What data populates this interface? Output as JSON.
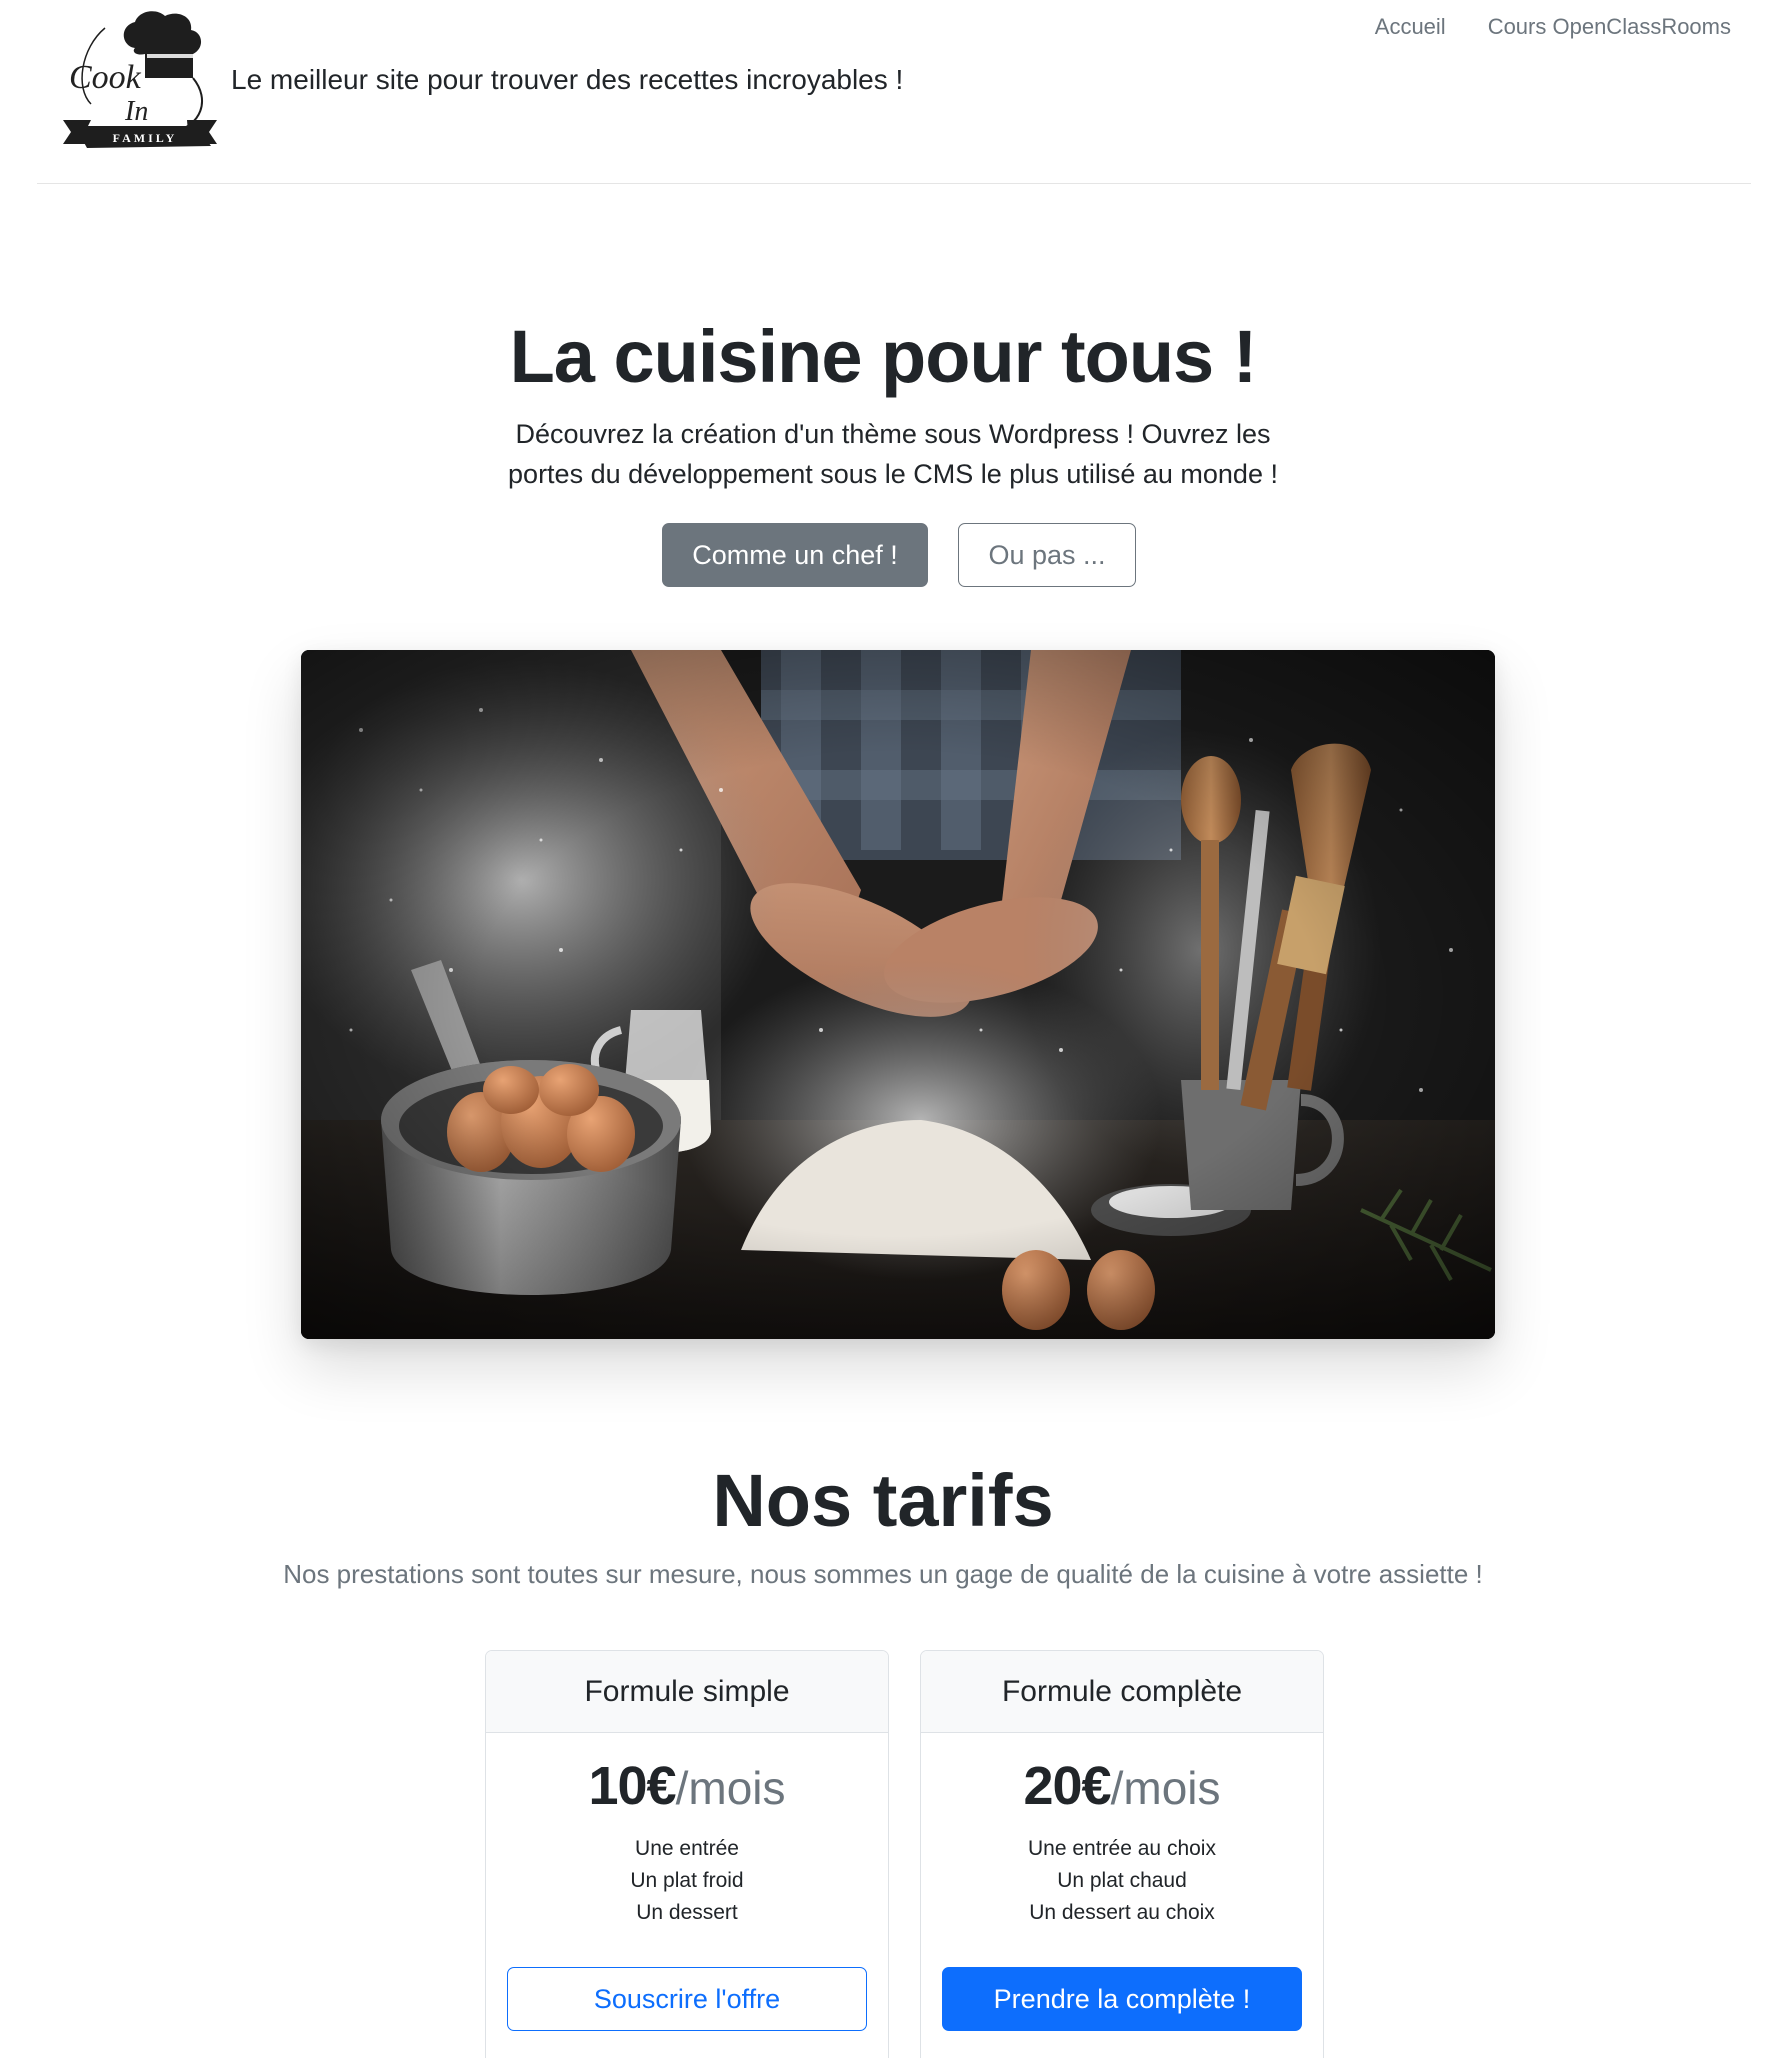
{
  "header": {
    "logo_text": {
      "cook": "Cook",
      "in": "In",
      "family": "FAMILY"
    },
    "tagline": "Le meilleur site pour trouver des recettes incroyables !",
    "nav": [
      {
        "label": "Accueil"
      },
      {
        "label": "Cours OpenClassRooms"
      }
    ]
  },
  "hero": {
    "title": "La cuisine pour tous !",
    "lead": "Découvrez la création d'un thème sous Wordpress ! Ouvrez les portes du développement sous le CMS le plus utilisé au monde !",
    "primary_button": "Comme un chef !",
    "secondary_button": "Ou pas ..."
  },
  "pricing": {
    "title": "Nos tarifs",
    "lead": "Nos prestations sont toutes sur mesure, nous sommes un gage de qualité de la cuisine à votre assiette !",
    "plans": [
      {
        "name": "Formule simple",
        "price": "10€",
        "period": "/mois",
        "features": [
          "Une entrée",
          "Un plat froid",
          "Un dessert"
        ],
        "button": "Souscrire l'offre"
      },
      {
        "name": "Formule complète",
        "price": "20€",
        "period": "/mois",
        "features": [
          "Une entrée au choix",
          "Un plat chaud",
          "Un dessert au choix"
        ],
        "button": "Prendre la complète !"
      }
    ]
  },
  "colors": {
    "primary": "#0d6efd",
    "secondary": "#6c757d",
    "text": "#212529",
    "card_header_bg": "#f8f9fa"
  }
}
